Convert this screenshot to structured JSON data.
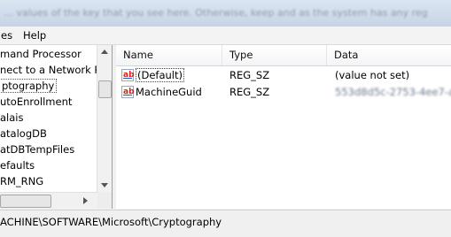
{
  "caption": {
    "text": "… values of the key that you see here. Otherwise, keep and as the system has any reg"
  },
  "menu": {
    "items": [
      "es",
      "Help"
    ]
  },
  "tree": {
    "items": [
      {
        "label": "mand Processor",
        "selected": false
      },
      {
        "label": "nect to a Network Prc",
        "selected": false
      },
      {
        "label": "ptography",
        "selected": true
      },
      {
        "label": "utoEnrollment",
        "selected": false
      },
      {
        "label": "alais",
        "selected": false
      },
      {
        "label": "atalogDB",
        "selected": false
      },
      {
        "label": "atDBTempFiles",
        "selected": false
      },
      {
        "label": "efaults",
        "selected": false
      },
      {
        "label": "RM_RNG",
        "selected": false
      }
    ]
  },
  "list": {
    "columns": {
      "name": "Name",
      "type": "Type",
      "data": "Data"
    },
    "rows": [
      {
        "icon": "ab",
        "name": "(Default)",
        "type": "REG_SZ",
        "data": "(value not set)",
        "data_blurred": false
      },
      {
        "icon": "ab",
        "name": "MachineGuid",
        "type": "REG_SZ",
        "data": "553d8d5c-2753-4ee7-afd9",
        "data_blurred": true
      }
    ]
  },
  "status": {
    "path": "ACHINE\\SOFTWARE\\Microsoft\\Cryptography"
  }
}
